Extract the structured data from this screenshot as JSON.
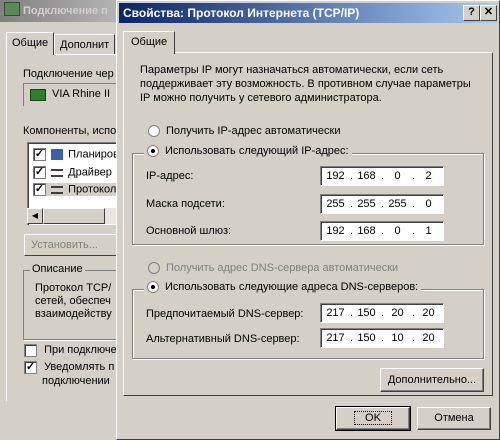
{
  "back_window": {
    "title": "Подключение п",
    "tabs": [
      "Общие",
      "Дополнит"
    ],
    "connect_using_label": "Подключение чер",
    "adapter_name": "VIA Rhine II",
    "components_label": "Компоненты, испо",
    "components": [
      {
        "checked": true,
        "label": "Планиров"
      },
      {
        "checked": true,
        "label": "Драйвер"
      },
      {
        "checked": true,
        "label": "Протокол"
      }
    ],
    "install_button": "Установить...",
    "description_group": "Описание",
    "description_lines": [
      "Протокол TCP/",
      "сетей, обеспеч",
      "взаимодейству"
    ],
    "show_icon_label": "При подключе",
    "notify_label_lines": [
      "Уведомлять п",
      "подключении"
    ],
    "check_glyph": "✓"
  },
  "dialog": {
    "title": "Свойства: Протокол Интернета (TCP/IP)",
    "help_button": "?",
    "close_button": "✕",
    "tab_general": "Общие",
    "intro_text": "Параметры IP могут назначаться автоматически, если сеть поддерживает эту возможность. В противном случае параметры IP можно получить у сетевого администратора.",
    "ip_auto_label": "Получить IP-адрес автоматически",
    "ip_manual_label": "Использовать следующий IP-адрес:",
    "ip_address_label": "IP-адрес:",
    "ip_address": [
      "192",
      "168",
      "0",
      "2"
    ],
    "subnet_label": "Маска подсети:",
    "subnet": [
      "255",
      "255",
      "255",
      "0"
    ],
    "gateway_label": "Основной шлюз:",
    "gateway": [
      "192",
      "168",
      "0",
      "1"
    ],
    "dns_auto_label": "Получить адрес DNS-сервера автоматически",
    "dns_manual_label": "Использовать следующие адреса DNS-серверов:",
    "dns_preferred_label": "Предпочитаемый DNS-сервер:",
    "dns_preferred": [
      "217",
      "150",
      "20",
      "20"
    ],
    "dns_alternate_label": "Альтернативный DNS-сервер:",
    "dns_alternate": [
      "217",
      "150",
      "10",
      "20"
    ],
    "advanced_button": "Дополнительно...",
    "ok_button": "OK",
    "cancel_button": "Отмена"
  }
}
